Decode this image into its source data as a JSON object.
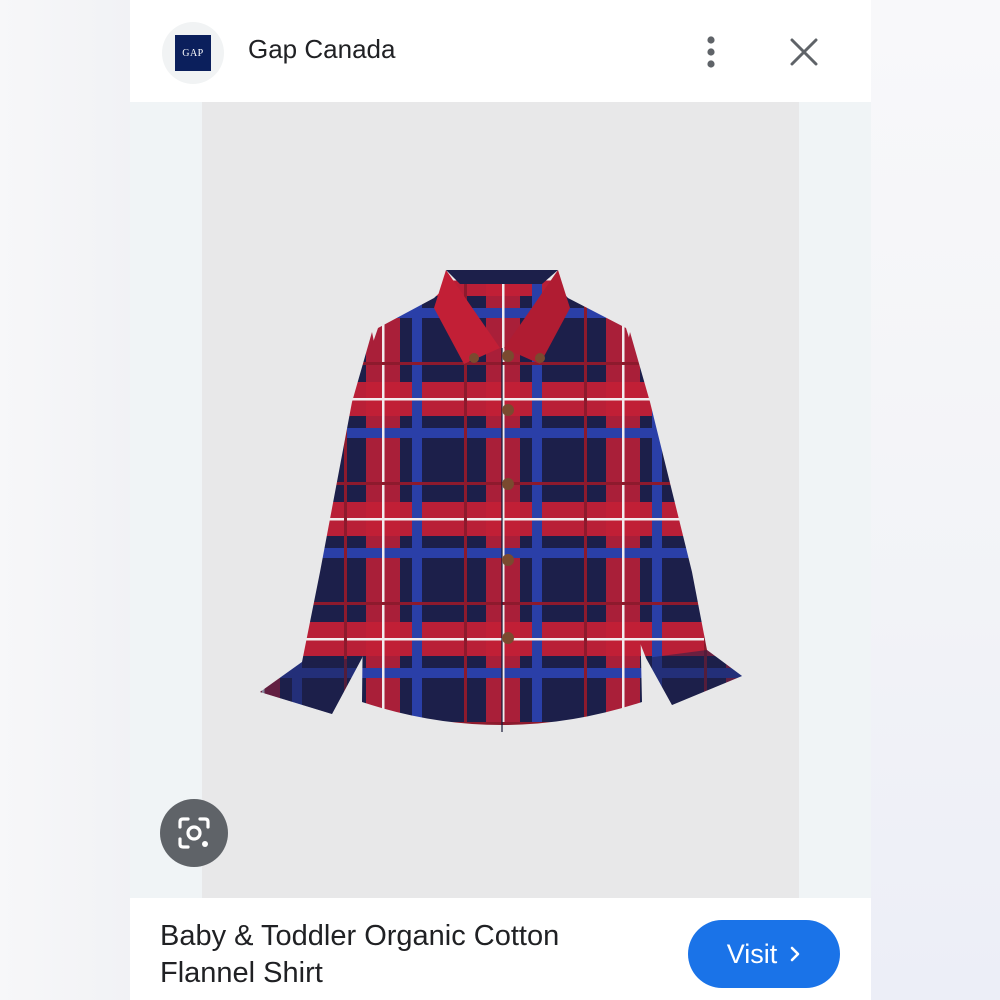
{
  "header": {
    "logo_text": "GAP",
    "site_name": "Gap Canada",
    "more_icon": "more-vert-icon",
    "close_icon": "close-icon"
  },
  "product": {
    "image_alt": "plaid flannel shirt",
    "colors": {
      "navy": "#1c1f4a",
      "red": "#c21f36",
      "blue": "#2a3fa8",
      "white": "#f2ecee",
      "button": "#7a4a2f"
    }
  },
  "lens": {
    "icon": "lens-icon"
  },
  "footer": {
    "title": "Baby & Toddler Organic Cotton Flannel Shirt",
    "visit_label": "Visit",
    "visit_icon": "chevron-right-icon",
    "accent": "#1a73e8"
  }
}
